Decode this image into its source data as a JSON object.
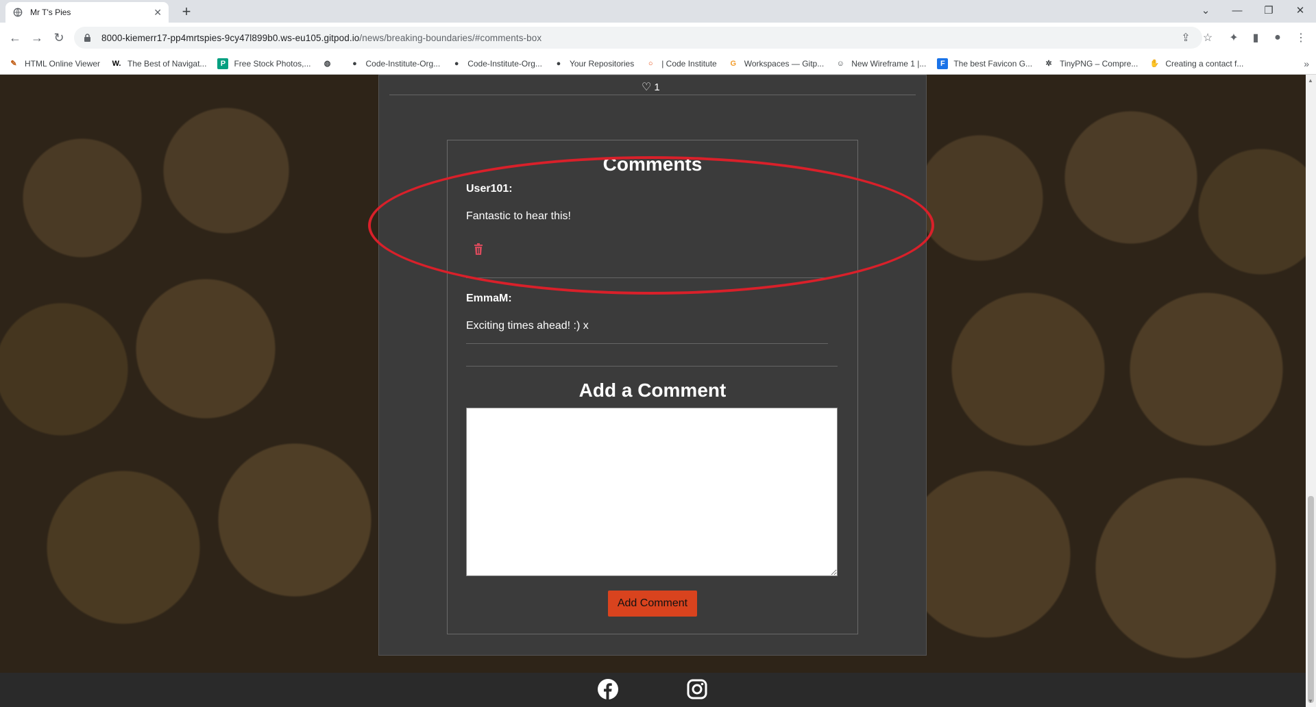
{
  "browser": {
    "tab_title": "Mr T's Pies",
    "tab_close": "✕",
    "new_tab": "+",
    "url_host": "8000-kiemerr17-pp4mrtspies-9cy47l899b0.ws-eu105.gitpod.io",
    "url_path": "/news/breaking-boundaries/#comments-box",
    "bookmarks": [
      {
        "label": "HTML Online Viewer",
        "icon": "pencil-icon"
      },
      {
        "label": "The Best of Navigat...",
        "icon": "w-icon"
      },
      {
        "label": "Free Stock Photos,...",
        "icon": "pexels-icon"
      },
      {
        "label": "",
        "icon": "globe-icon"
      },
      {
        "label": "Code-Institute-Org...",
        "icon": "github-icon"
      },
      {
        "label": "Code-Institute-Org...",
        "icon": "github-icon"
      },
      {
        "label": "Your Repositories",
        "icon": "github-icon"
      },
      {
        "label": "| Code Institute",
        "icon": "code-institute-icon"
      },
      {
        "label": "Workspaces — Gitp...",
        "icon": "gitpod-icon"
      },
      {
        "label": "New Wireframe 1 |...",
        "icon": "smiley-icon"
      },
      {
        "label": "The best Favicon G...",
        "icon": "favicon-icon"
      },
      {
        "label": "TinyPNG – Compre...",
        "icon": "panda-icon"
      },
      {
        "label": "Creating a contact f...",
        "icon": "hand-icon"
      }
    ]
  },
  "post": {
    "likes_count": "1"
  },
  "comments": {
    "title": "Comments",
    "items": [
      {
        "author": "User101:",
        "body": "Fantastic to hear this!"
      },
      {
        "author": "EmmaM:",
        "body": "Exciting times ahead! :) x"
      }
    ]
  },
  "add_comment": {
    "title": "Add a Comment",
    "input_value": "",
    "button_label": "Add Comment"
  },
  "colors": {
    "accent_button": "#d9431e",
    "highlight_annotation": "#d9202a",
    "delete_icon": "#d94a5c",
    "card_bg": "#3b3b3b"
  }
}
